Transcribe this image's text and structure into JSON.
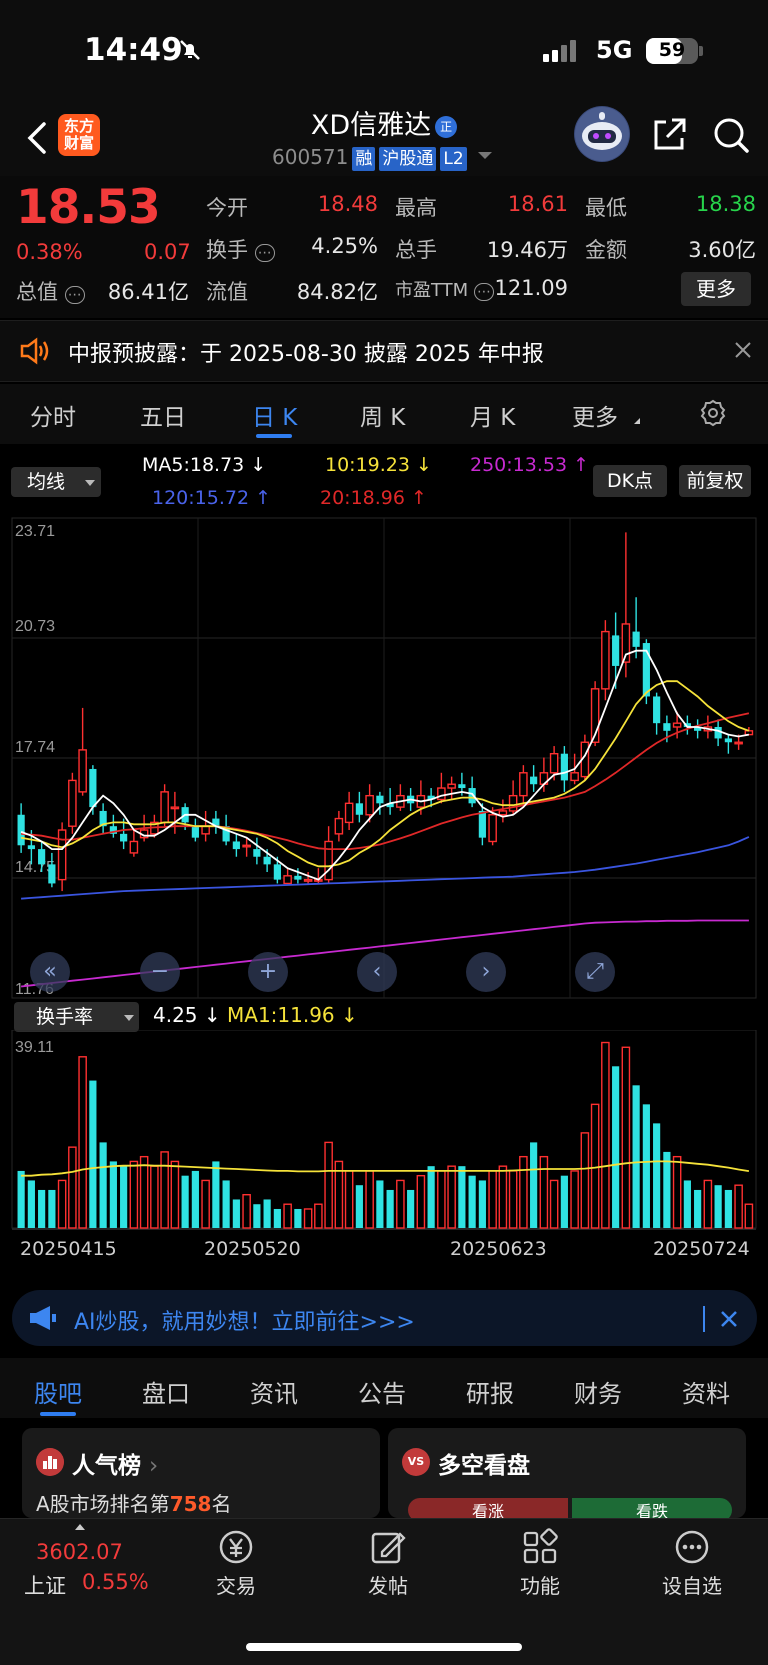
{
  "status_bar": {
    "time": "14:49",
    "network": "5G",
    "battery": "59",
    "battery_level": 0.59
  },
  "header": {
    "logo_text": "东方\n财富",
    "stock_name": "XD信雅达",
    "name_badge": "正",
    "stock_code": "600571",
    "tags": [
      "融",
      "沪股通",
      "L2"
    ]
  },
  "quote": {
    "price": "18.53",
    "change_pct": "0.38%",
    "change": "0.07",
    "fields": [
      {
        "label": "今开",
        "value": "18.48",
        "color": "#f23b3b"
      },
      {
        "label": "最高",
        "value": "18.61",
        "color": "#f23b3b"
      },
      {
        "label": "最低",
        "value": "18.38",
        "color": "#27d44b"
      },
      {
        "label": "换手",
        "value": "4.25%",
        "color": "#e6e6e6"
      },
      {
        "label": "总手",
        "value": "19.46万",
        "color": "#e6e6e6"
      },
      {
        "label": "金额",
        "value": "3.60亿",
        "color": "#e6e6e6"
      },
      {
        "label": "总值",
        "value": "86.41亿",
        "color": "#e6e6e6"
      },
      {
        "label": "流值",
        "value": "84.82亿",
        "color": "#e6e6e6"
      },
      {
        "label": "市盈TTM",
        "value": "121.09",
        "color": "#e6e6e6"
      }
    ],
    "more_label": "更多"
  },
  "notice": {
    "text": "中报预披露：于 2025-08-30 披露 2025 年中报"
  },
  "period_tabs": [
    "分时",
    "五日",
    "日 K",
    "周 K",
    "月 K",
    "更多"
  ],
  "active_period": "日 K",
  "ma_legend": {
    "selector": "均线",
    "ma5": "MA5:18.73 ↓",
    "ma10": "10:19.23 ↓",
    "ma250": "250:13.53 ↑",
    "ma120": "120:15.72 ↑",
    "ma20": "20:18.96 ↑",
    "dk_label": "DK点",
    "fq_label": "前复权",
    "colors": {
      "ma5": "#ffffff",
      "ma10": "#f5e23a",
      "ma20": "#e02828",
      "ma120": "#3a55e0",
      "ma250": "#c72ad0"
    }
  },
  "chart_data": [
    {
      "type": "candlestick",
      "title": "",
      "y_ticks": [
        "23.71",
        "20.73",
        "17.74",
        "14.75",
        "11.76"
      ],
      "ylim": [
        11.76,
        23.71
      ],
      "x_ticks": [
        "20250415",
        "20250520",
        "20250623",
        "20250724"
      ],
      "candles": [
        [
          16.3,
          15.5,
          16.6,
          15.3
        ],
        [
          15.5,
          15.4,
          15.9,
          15.0
        ],
        [
          15.4,
          15.0,
          15.6,
          14.8
        ],
        [
          15.0,
          14.5,
          15.3,
          14.4
        ],
        [
          14.6,
          15.9,
          16.1,
          14.3
        ],
        [
          16.0,
          17.2,
          17.4,
          15.8
        ],
        [
          16.9,
          18.0,
          19.1,
          16.8
        ],
        [
          17.5,
          16.5,
          17.6,
          16.3
        ],
        [
          16.4,
          16.0,
          16.6,
          15.8
        ],
        [
          16.0,
          15.8,
          16.3,
          15.7
        ],
        [
          15.8,
          15.6,
          16.2,
          15.4
        ],
        [
          15.3,
          15.6,
          15.9,
          15.2
        ],
        [
          15.7,
          15.9,
          16.3,
          15.6
        ],
        [
          15.8,
          16.1,
          16.3,
          15.7
        ],
        [
          16.1,
          16.9,
          17.1,
          16.0
        ],
        [
          16.5,
          16.5,
          16.9,
          15.8
        ],
        [
          16.5,
          16.1,
          16.6,
          15.9
        ],
        [
          16.0,
          15.7,
          16.2,
          15.6
        ],
        [
          15.8,
          16.0,
          16.4,
          15.6
        ],
        [
          16.2,
          16.0,
          16.4,
          15.8
        ],
        [
          16.0,
          15.6,
          16.3,
          15.5
        ],
        [
          15.6,
          15.4,
          15.8,
          15.2
        ],
        [
          15.5,
          15.5,
          15.7,
          15.2
        ],
        [
          15.4,
          15.2,
          15.7,
          15.0
        ],
        [
          15.2,
          15.0,
          15.4,
          14.8
        ],
        [
          15.0,
          14.6,
          15.2,
          14.5
        ],
        [
          14.5,
          14.7,
          14.9,
          14.5
        ],
        [
          14.7,
          14.6,
          14.9,
          14.5
        ],
        [
          14.6,
          14.6,
          14.8,
          14.5
        ],
        [
          14.6,
          14.6,
          14.9,
          14.5
        ],
        [
          14.6,
          15.6,
          16.0,
          14.5
        ],
        [
          15.8,
          16.2,
          16.4,
          15.6
        ],
        [
          16.1,
          16.6,
          16.9,
          15.9
        ],
        [
          16.6,
          16.3,
          16.9,
          16.1
        ],
        [
          16.3,
          16.8,
          17.1,
          16.1
        ],
        [
          16.8,
          16.6,
          16.9,
          16.3
        ],
        [
          16.6,
          16.5,
          17.0,
          16.3
        ],
        [
          16.5,
          16.8,
          17.1,
          16.4
        ],
        [
          16.8,
          16.6,
          17.0,
          16.4
        ],
        [
          16.5,
          16.8,
          17.2,
          16.3
        ],
        [
          16.8,
          16.7,
          17.0,
          16.5
        ],
        [
          16.7,
          17.0,
          17.4,
          16.6
        ],
        [
          17.0,
          17.1,
          17.3,
          16.7
        ],
        [
          17.1,
          17.0,
          17.4,
          16.8
        ],
        [
          17.0,
          16.6,
          17.3,
          16.5
        ],
        [
          16.4,
          15.7,
          16.6,
          15.5
        ],
        [
          15.6,
          16.3,
          16.5,
          15.5
        ],
        [
          16.3,
          16.4,
          16.7,
          16.1
        ],
        [
          16.4,
          16.8,
          17.2,
          16.3
        ],
        [
          16.8,
          17.4,
          17.6,
          16.5
        ],
        [
          17.3,
          17.1,
          17.6,
          16.9
        ],
        [
          17.1,
          17.4,
          17.8,
          16.9
        ],
        [
          17.4,
          17.9,
          18.1,
          17.2
        ],
        [
          17.9,
          17.2,
          18.1,
          16.9
        ],
        [
          17.2,
          17.4,
          17.9,
          17.1
        ],
        [
          17.3,
          18.2,
          18.4,
          17.2
        ],
        [
          18.2,
          19.6,
          19.8,
          18.1
        ],
        [
          19.6,
          21.1,
          21.4,
          19.3
        ],
        [
          21.0,
          20.2,
          21.6,
          19.6
        ],
        [
          20.3,
          21.3,
          23.7,
          19.9
        ],
        [
          21.1,
          20.7,
          22.0,
          20.4
        ],
        [
          20.8,
          19.4,
          20.9,
          19.2
        ],
        [
          19.4,
          18.7,
          19.5,
          18.4
        ],
        [
          18.7,
          18.5,
          18.9,
          18.2
        ],
        [
          18.6,
          18.7,
          19.0,
          18.3
        ],
        [
          18.7,
          18.6,
          18.9,
          18.4
        ],
        [
          18.6,
          18.5,
          18.8,
          18.3
        ],
        [
          18.5,
          18.6,
          18.9,
          18.3
        ],
        [
          18.6,
          18.3,
          18.8,
          18.1
        ],
        [
          18.3,
          18.2,
          18.4,
          17.9
        ],
        [
          18.2,
          18.2,
          18.4,
          18.0
        ],
        [
          18.4,
          18.5,
          18.6,
          18.4
        ]
      ],
      "ma5": [
        15.85,
        15.75,
        15.6,
        15.4,
        15.4,
        15.7,
        16.1,
        16.5,
        16.8,
        16.6,
        16.3,
        15.9,
        15.75,
        15.75,
        15.9,
        16.1,
        16.3,
        16.3,
        16.15,
        16.0,
        15.9,
        15.8,
        15.7,
        15.5,
        15.3,
        15.1,
        14.9,
        14.8,
        14.7,
        14.6,
        14.85,
        15.15,
        15.5,
        15.9,
        16.2,
        16.5,
        16.6,
        16.65,
        16.7,
        16.65,
        16.7,
        16.8,
        16.85,
        16.9,
        16.85,
        16.5,
        16.35,
        16.25,
        16.3,
        16.5,
        16.8,
        17.1,
        17.35,
        17.4,
        17.5,
        17.85,
        18.4,
        19.1,
        19.8,
        20.5,
        20.6,
        20.6,
        20.1,
        19.5,
        18.95,
        18.6,
        18.6,
        18.55,
        18.5,
        18.4,
        18.35,
        18.4
      ],
      "ma10": [
        15.7,
        15.65,
        15.6,
        15.5,
        15.45,
        15.55,
        15.7,
        15.9,
        16.05,
        16.1,
        16.1,
        16.05,
        16.05,
        16.05,
        16.1,
        16.1,
        16.05,
        16.0,
        16.0,
        16.0,
        15.95,
        15.9,
        15.85,
        15.8,
        15.7,
        15.55,
        15.35,
        15.2,
        15.05,
        14.95,
        14.95,
        15.0,
        15.1,
        15.3,
        15.45,
        15.65,
        15.9,
        16.1,
        16.3,
        16.45,
        16.55,
        16.65,
        16.7,
        16.75,
        16.75,
        16.7,
        16.6,
        16.55,
        16.55,
        16.6,
        16.65,
        16.7,
        16.75,
        16.85,
        17.0,
        17.2,
        17.5,
        17.9,
        18.3,
        18.75,
        19.2,
        19.5,
        19.7,
        19.8,
        19.8,
        19.6,
        19.4,
        19.15,
        18.95,
        18.75,
        18.6,
        18.5
      ],
      "ma20": [
        15.8,
        15.78,
        15.75,
        15.7,
        15.65,
        15.65,
        15.7,
        15.75,
        15.8,
        15.85,
        15.9,
        15.92,
        15.95,
        15.97,
        15.98,
        16.0,
        16.0,
        16.0,
        16.0,
        16.0,
        15.97,
        15.93,
        15.88,
        15.82,
        15.76,
        15.7,
        15.63,
        15.55,
        15.48,
        15.42,
        15.4,
        15.4,
        15.4,
        15.43,
        15.47,
        15.52,
        15.6,
        15.68,
        15.77,
        15.87,
        15.97,
        16.07,
        16.15,
        16.23,
        16.3,
        16.35,
        16.4,
        16.45,
        16.5,
        16.55,
        16.6,
        16.65,
        16.7,
        16.75,
        16.82,
        16.9,
        17.05,
        17.22,
        17.4,
        17.6,
        17.8,
        18.0,
        18.18,
        18.33,
        18.45,
        18.55,
        18.63,
        18.7,
        18.77,
        18.84,
        18.9,
        18.96
      ],
      "ma120": [
        14.1,
        14.12,
        14.14,
        14.16,
        14.18,
        14.2,
        14.22,
        14.24,
        14.26,
        14.28,
        14.3,
        14.31,
        14.32,
        14.33,
        14.34,
        14.35,
        14.36,
        14.37,
        14.38,
        14.39,
        14.4,
        14.41,
        14.42,
        14.43,
        14.44,
        14.45,
        14.46,
        14.47,
        14.48,
        14.49,
        14.5,
        14.51,
        14.52,
        14.53,
        14.54,
        14.55,
        14.56,
        14.57,
        14.58,
        14.59,
        14.6,
        14.61,
        14.62,
        14.63,
        14.64,
        14.65,
        14.66,
        14.67,
        14.68,
        14.7,
        14.72,
        14.74,
        14.76,
        14.78,
        14.8,
        14.83,
        14.86,
        14.9,
        14.94,
        14.98,
        15.02,
        15.07,
        15.12,
        15.17,
        15.22,
        15.27,
        15.32,
        15.38,
        15.44,
        15.5,
        15.6,
        15.72
      ],
      "ma250": [
        11.8,
        11.83,
        11.86,
        11.89,
        11.92,
        11.95,
        11.98,
        12.01,
        12.04,
        12.07,
        12.1,
        12.13,
        12.16,
        12.19,
        12.22,
        12.25,
        12.28,
        12.31,
        12.34,
        12.37,
        12.4,
        12.43,
        12.46,
        12.49,
        12.52,
        12.55,
        12.58,
        12.61,
        12.64,
        12.67,
        12.7,
        12.73,
        12.76,
        12.79,
        12.82,
        12.85,
        12.88,
        12.91,
        12.94,
        12.97,
        13.0,
        13.03,
        13.06,
        13.09,
        13.12,
        13.15,
        13.18,
        13.21,
        13.24,
        13.27,
        13.3,
        13.33,
        13.36,
        13.39,
        13.42,
        13.45,
        13.47,
        13.48,
        13.49,
        13.5,
        13.5,
        13.51,
        13.51,
        13.52,
        13.52,
        13.52,
        13.53,
        13.53,
        13.53,
        13.53,
        13.53,
        13.53
      ]
    },
    {
      "type": "bar",
      "title": "",
      "y_ticks": [
        "39.11"
      ],
      "ylim": [
        0,
        39.11
      ],
      "x_ticks": [
        "20250415",
        "20250520",
        "20250623",
        "20250724"
      ],
      "values": [
        12,
        10,
        8,
        8,
        10,
        17,
        36,
        31,
        18,
        14,
        13,
        14,
        15,
        13,
        16,
        14,
        11,
        12,
        10,
        14,
        10,
        6,
        7,
        5,
        6,
        4,
        5,
        4,
        4,
        5,
        18,
        14,
        12,
        9,
        12,
        10,
        8,
        10,
        8,
        11,
        13,
        12,
        13,
        13,
        11,
        10,
        12,
        13,
        12,
        15,
        18,
        15,
        10,
        11,
        12,
        20,
        26,
        39,
        34,
        38,
        30,
        26,
        22,
        16,
        15,
        10,
        8,
        10,
        9,
        8,
        9,
        5
      ],
      "ma": [
        11.0,
        11.0,
        11.2,
        11.3,
        11.5,
        11.8,
        12.3,
        12.6,
        12.8,
        13.0,
        13.1,
        13.1,
        13.2,
        13.1,
        13.1,
        13.0,
        12.9,
        12.8,
        12.7,
        12.6,
        12.5,
        12.4,
        12.3,
        12.2,
        12.1,
        12.0,
        12.0,
        11.9,
        11.9,
        11.9,
        12.0,
        12.0,
        12.0,
        12.0,
        12.0,
        12.0,
        12.0,
        12.0,
        12.0,
        12.0,
        12.0,
        12.0,
        12.0,
        12.0,
        12.0,
        12.0,
        12.0,
        12.0,
        12.1,
        12.2,
        12.3,
        12.4,
        12.4,
        12.4,
        12.4,
        12.5,
        12.7,
        13.0,
        13.3,
        13.6,
        13.8,
        13.9,
        14.0,
        14.0,
        13.9,
        13.7,
        13.5,
        13.3,
        13.0,
        12.7,
        12.3,
        11.96
      ]
    }
  ],
  "turnover": {
    "selector": "换手率",
    "value": "4.25 ↓",
    "ma": "MA1:11.96 ↓"
  },
  "ai_banner": {
    "text": "AI炒股，就用妙想！立即前往>>>"
  },
  "bottom_tabs": [
    "股吧",
    "盘口",
    "资讯",
    "公告",
    "研报",
    "财务",
    "资料"
  ],
  "cards": {
    "popularity": {
      "title": "人气榜",
      "sub_prefix": "A股市场排名第",
      "rank": "758",
      "sub_suffix": "名"
    },
    "bullbear": {
      "title": "多空看盘",
      "icon_text": "VS",
      "up": "看涨",
      "down": "看跌"
    }
  },
  "bottom_nav": {
    "index_value": "3602.07",
    "index_name": "上证",
    "index_pct": "0.55%",
    "items": [
      "交易",
      "发帖",
      "功能",
      "设自选"
    ]
  }
}
